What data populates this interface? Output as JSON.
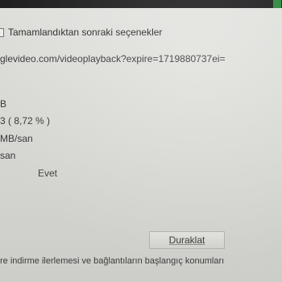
{
  "window": {
    "title": ""
  },
  "options": {
    "after_complete_label": "Tamamlandıktan sonraki seçenekler"
  },
  "download": {
    "url": "glevideo.com/videoplayback?expire=1719880737ei=",
    "file_size": "B",
    "downloaded": "3 ( 8,72 % )",
    "transfer_rate": "MB/san",
    "time_left": "san",
    "resume_capability": "Evet"
  },
  "actions": {
    "pause_label": "Duraklat"
  },
  "footer": {
    "info_text": "re indirme ilerlemesi ve bağlantıların başlangıç konumları"
  }
}
